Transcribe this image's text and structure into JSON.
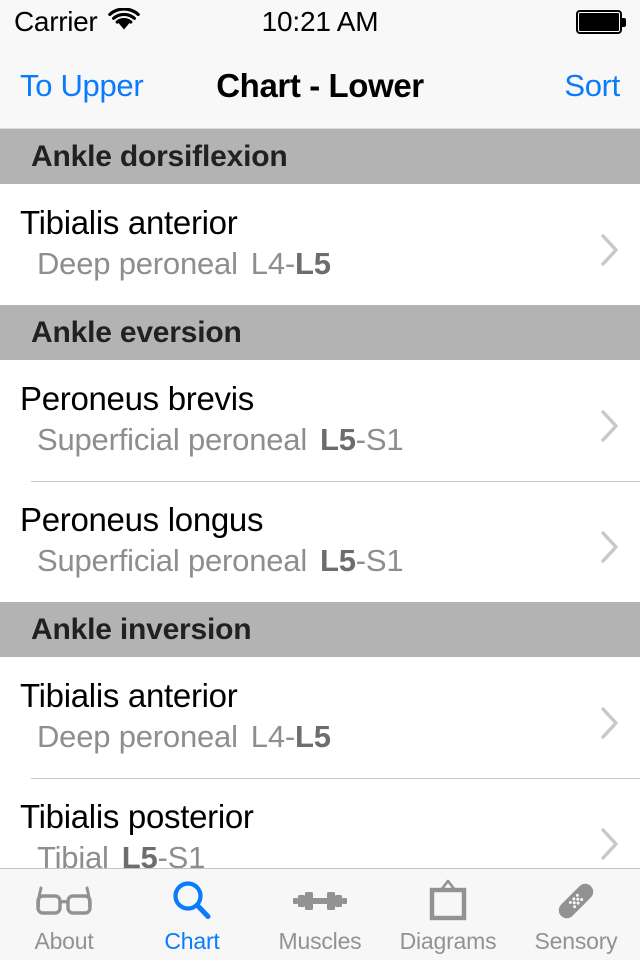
{
  "status_bar": {
    "carrier": "Carrier",
    "wifi_icon": "wifi-icon",
    "time": "10:21 AM",
    "battery_icon": "battery-full-icon"
  },
  "nav_bar": {
    "back_label": "To Upper",
    "title": "Chart - Lower",
    "sort_label": "Sort",
    "tint_color": "#0a7cfb"
  },
  "list": {
    "sections": [
      {
        "header": "Ankle dorsiflexion",
        "rows": [
          {
            "muscle": "Tibialis anterior",
            "nerve": "Deep peroneal",
            "root_pre": "L4-",
            "root_bold": "L5",
            "root_post": ""
          }
        ]
      },
      {
        "header": "Ankle eversion",
        "rows": [
          {
            "muscle": "Peroneus brevis",
            "nerve": "Superficial peroneal",
            "root_pre": "",
            "root_bold": "L5",
            "root_post": "-S1"
          },
          {
            "muscle": "Peroneus longus",
            "nerve": "Superficial peroneal",
            "root_pre": "",
            "root_bold": "L5",
            "root_post": "-S1"
          }
        ]
      },
      {
        "header": "Ankle inversion",
        "rows": [
          {
            "muscle": "Tibialis anterior",
            "nerve": "Deep peroneal",
            "root_pre": "L4-",
            "root_bold": "L5",
            "root_post": ""
          },
          {
            "muscle": "Tibialis posterior",
            "nerve": "Tibial",
            "root_pre": "",
            "root_bold": "L5",
            "root_post": "-S1"
          }
        ]
      }
    ],
    "disclosure_icon": "chevron-right-icon",
    "section_header_color": "#b3b3b3"
  },
  "tab_bar": {
    "active_color": "#0a7cfb",
    "inactive_color": "#929292",
    "tabs": [
      {
        "label": "About",
        "icon": "glasses-icon",
        "active": false
      },
      {
        "label": "Chart",
        "icon": "magnifier-icon",
        "active": true
      },
      {
        "label": "Muscles",
        "icon": "dumbbell-icon",
        "active": false
      },
      {
        "label": "Diagrams",
        "icon": "picture-frame-icon",
        "active": false
      },
      {
        "label": "Sensory",
        "icon": "bandage-icon",
        "active": false
      }
    ]
  }
}
